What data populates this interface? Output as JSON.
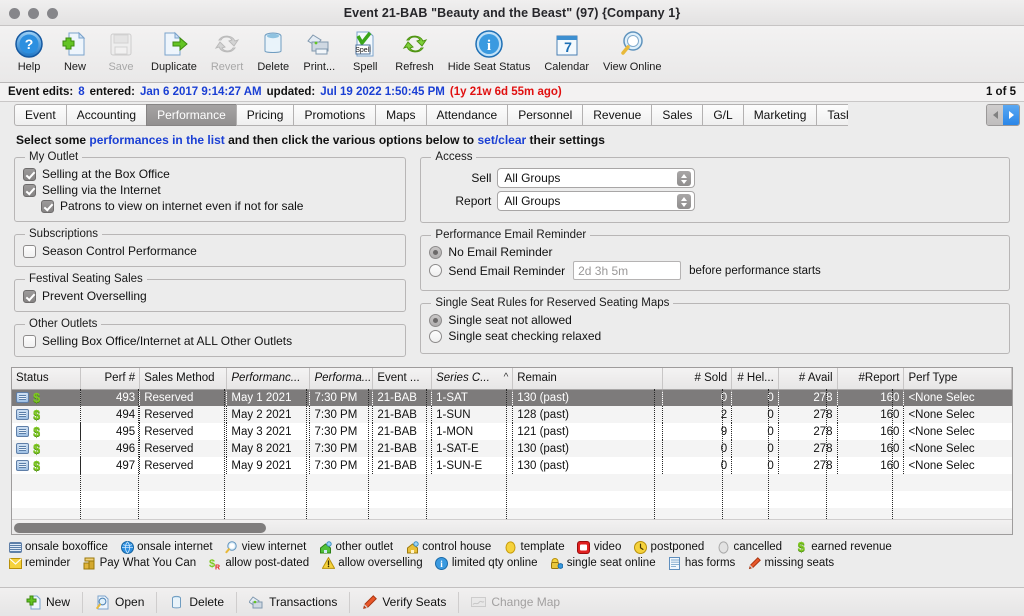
{
  "window": {
    "title": "Event 21-BAB \"Beauty and the Beast\" (97) {Company 1}"
  },
  "toolbar": {
    "buttons": [
      {
        "label": "Help",
        "icon": "help-icon",
        "disabled": false
      },
      {
        "label": "New",
        "icon": "new-document-icon",
        "disabled": false
      },
      {
        "label": "Save",
        "icon": "save-floppy-icon",
        "disabled": true
      },
      {
        "label": "Duplicate",
        "icon": "duplicate-icon",
        "disabled": false
      },
      {
        "label": "Revert",
        "icon": "revert-refresh-icon",
        "disabled": true
      },
      {
        "label": "Delete",
        "icon": "trash-icon",
        "disabled": false
      },
      {
        "label": "Print...",
        "icon": "printer-icon",
        "disabled": false
      },
      {
        "label": "Spell",
        "icon": "spellcheck-icon",
        "disabled": false
      },
      {
        "label": "Refresh",
        "icon": "refresh-icon",
        "disabled": false
      },
      {
        "label": "Hide Seat Status",
        "icon": "info-icon",
        "disabled": false
      },
      {
        "label": "Calendar",
        "icon": "calendar-icon",
        "disabled": false
      },
      {
        "label": "View Online",
        "icon": "magnifier-globe-icon",
        "disabled": false
      }
    ]
  },
  "infobar": {
    "edits_label": "Event edits:",
    "edits_value": "8",
    "entered_label": "entered:",
    "entered_value": "Jan 6 2017 9:14:27 AM",
    "updated_label": "updated:",
    "updated_value": "Jul 19 2022 1:50:45 PM",
    "ago": "(1y 21w 6d 55m ago)",
    "record_count": "1 of 5"
  },
  "tabs": {
    "items": [
      {
        "label": "Event",
        "active": false
      },
      {
        "label": "Accounting",
        "active": false
      },
      {
        "label": "Performance",
        "active": true
      },
      {
        "label": "Pricing",
        "active": false
      },
      {
        "label": "Promotions",
        "active": false
      },
      {
        "label": "Maps",
        "active": false
      },
      {
        "label": "Attendance",
        "active": false
      },
      {
        "label": "Personnel",
        "active": false
      },
      {
        "label": "Revenue",
        "active": false
      },
      {
        "label": "Sales",
        "active": false
      },
      {
        "label": "G/L",
        "active": false
      },
      {
        "label": "Marketing",
        "active": false
      },
      {
        "label": "Task",
        "active": false
      }
    ]
  },
  "instruction": {
    "part1": "Select some",
    "link1": "performances in the list",
    "part2": "and then click the various options below to",
    "link2": "set/clear",
    "part3": "their settings"
  },
  "my_outlet": {
    "legend": "My Outlet",
    "items": [
      {
        "label": "Selling at the Box Office",
        "checked": true,
        "indent": false
      },
      {
        "label": "Selling via the Internet",
        "checked": true,
        "indent": false
      },
      {
        "label": "Patrons to view on internet even if not for sale",
        "checked": true,
        "indent": true
      }
    ]
  },
  "subscriptions": {
    "legend": "Subscriptions",
    "items": [
      {
        "label": "Season Control Performance",
        "checked": false,
        "indent": false
      }
    ]
  },
  "festival": {
    "legend": "Festival Seating Sales",
    "items": [
      {
        "label": "Prevent Overselling",
        "checked": true,
        "indent": false
      }
    ]
  },
  "other_outlets": {
    "legend": "Other Outlets",
    "items": [
      {
        "label": "Selling Box Office/Internet at ALL Other Outlets",
        "checked": false,
        "indent": false
      }
    ]
  },
  "access": {
    "legend": "Access",
    "sell_label": "Sell",
    "sell_value": "All Groups",
    "report_label": "Report",
    "report_value": "All Groups"
  },
  "email_reminder": {
    "legend": "Performance Email Reminder",
    "option_none": "No Email Reminder",
    "option_send": "Send Email Reminder",
    "selected": "none",
    "interval_placeholder": "2d 3h 5m",
    "interval_value": "",
    "suffix": "before performance starts"
  },
  "single_seat": {
    "legend": "Single Seat Rules for Reserved Seating Maps",
    "option_not_allowed": "Single seat not allowed",
    "option_relaxed": "Single seat checking relaxed",
    "selected": "not_allowed"
  },
  "table": {
    "columns": [
      {
        "label": "Status",
        "align": "left",
        "italic": false
      },
      {
        "label": "Perf #",
        "align": "right",
        "italic": false
      },
      {
        "label": "Sales Method",
        "align": "left",
        "italic": false
      },
      {
        "label": "Performanc...",
        "align": "left",
        "italic": true
      },
      {
        "label": "Performa...",
        "align": "left",
        "italic": true
      },
      {
        "label": "Event ...",
        "align": "left",
        "italic": false
      },
      {
        "label": "Series C...",
        "align": "left",
        "italic": true,
        "sorted": true,
        "sort_caret": "^"
      },
      {
        "label": "Remain",
        "align": "left",
        "italic": false
      },
      {
        "label": "# Sold",
        "align": "right",
        "italic": false
      },
      {
        "label": "# Hel...",
        "align": "right",
        "italic": false
      },
      {
        "label": "# Avail",
        "align": "right",
        "italic": false
      },
      {
        "label": "#Report",
        "align": "right",
        "italic": false
      },
      {
        "label": "Perf Type",
        "align": "left",
        "italic": false
      }
    ],
    "rows": [
      {
        "selected": true,
        "status_icons": [
          "onsale-boxoffice-icon",
          "earned-revenue-icon"
        ],
        "perf_num": "493",
        "sales_method": "Reserved",
        "perf_date": "May 1 2021",
        "perf_time": "7:30 PM",
        "event": "21-BAB",
        "series": "1-SAT",
        "remain": "130 (past)",
        "sold": "0",
        "held": "0",
        "avail": "278",
        "report": "160",
        "perf_type": "<None Selec"
      },
      {
        "selected": false,
        "status_icons": [
          "onsale-boxoffice-icon",
          "earned-revenue-icon"
        ],
        "perf_num": "494",
        "sales_method": "Reserved",
        "perf_date": "May 2 2021",
        "perf_time": "7:30 PM",
        "event": "21-BAB",
        "series": "1-SUN",
        "remain": "128 (past)",
        "sold": "2",
        "held": "0",
        "avail": "278",
        "report": "160",
        "perf_type": "<None Selec"
      },
      {
        "selected": false,
        "status_icons": [
          "onsale-boxoffice-icon",
          "earned-revenue-icon"
        ],
        "perf_num": "495",
        "sales_method": "Reserved",
        "perf_date": "May 3 2021",
        "perf_time": "7:30 PM",
        "event": "21-BAB",
        "series": "1-MON",
        "remain": "121 (past)",
        "sold": "9",
        "held": "0",
        "avail": "278",
        "report": "160",
        "perf_type": "<None Selec"
      },
      {
        "selected": false,
        "status_icons": [
          "onsale-boxoffice-icon",
          "earned-revenue-icon"
        ],
        "perf_num": "496",
        "sales_method": "Reserved",
        "perf_date": "May 8 2021",
        "perf_time": "7:30 PM",
        "event": "21-BAB",
        "series": "1-SAT-E",
        "remain": "130 (past)",
        "sold": "0",
        "held": "0",
        "avail": "278",
        "report": "160",
        "perf_type": "<None Selec"
      },
      {
        "selected": false,
        "status_icons": [
          "onsale-boxoffice-icon",
          "earned-revenue-icon"
        ],
        "perf_num": "497",
        "sales_method": "Reserved",
        "perf_date": "May 9 2021",
        "perf_time": "7:30 PM",
        "event": "21-BAB",
        "series": "1-SUN-E",
        "remain": "130 (past)",
        "sold": "0",
        "held": "0",
        "avail": "278",
        "report": "160",
        "perf_type": "<None Selec"
      }
    ]
  },
  "legend": {
    "row1": [
      {
        "icon": "onsale-boxoffice-icon",
        "label": "onsale boxoffice"
      },
      {
        "icon": "onsale-internet-icon",
        "label": "onsale internet"
      },
      {
        "icon": "view-internet-icon",
        "label": "view internet"
      },
      {
        "icon": "other-outlet-icon",
        "label": "other outlet"
      },
      {
        "icon": "control-house-icon",
        "label": "control house"
      },
      {
        "icon": "template-icon",
        "label": "template"
      },
      {
        "icon": "video-icon",
        "label": "video"
      },
      {
        "icon": "postponed-icon",
        "label": "postponed"
      },
      {
        "icon": "cancelled-icon",
        "label": "cancelled"
      },
      {
        "icon": "earned-revenue-icon",
        "label": "earned revenue"
      }
    ],
    "row2": [
      {
        "icon": "reminder-icon",
        "label": "reminder"
      },
      {
        "icon": "pay-what-you-can-icon",
        "label": "Pay What You Can"
      },
      {
        "icon": "allow-post-dated-icon",
        "label": "allow post-dated"
      },
      {
        "icon": "allow-overselling-icon",
        "label": "allow overselling"
      },
      {
        "icon": "limited-qty-online-icon",
        "label": "limited qty online"
      },
      {
        "icon": "single-seat-online-icon",
        "label": "single seat online"
      },
      {
        "icon": "has-forms-icon",
        "label": "has forms"
      },
      {
        "icon": "missing-seats-icon",
        "label": "missing seats"
      }
    ]
  },
  "bottombar": {
    "buttons": [
      {
        "label": "New",
        "icon": "new-plus-icon",
        "disabled": false
      },
      {
        "label": "Open",
        "icon": "open-magnifier-icon",
        "disabled": false
      },
      {
        "label": "Delete",
        "icon": "trash-icon",
        "disabled": false
      },
      {
        "label": "Transactions",
        "icon": "transactions-icon",
        "disabled": false
      },
      {
        "label": "Verify Seats",
        "icon": "verify-seats-icon",
        "disabled": false
      },
      {
        "label": "Change Map",
        "icon": "change-map-icon",
        "disabled": true
      }
    ]
  }
}
